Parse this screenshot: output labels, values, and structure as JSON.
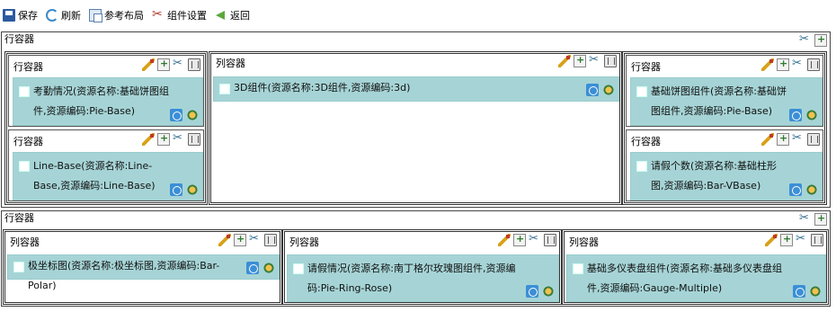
{
  "toolbar": {
    "save": "保存",
    "refresh": "刷新",
    "reference_layout": "参考布局",
    "component_settings": "组件设置",
    "back": "返回"
  },
  "row1": {
    "title": "行容器",
    "left_top": {
      "title": "行容器",
      "card": "考勤情况(资源名称:基础饼图组件,资源编码:Pie-Base)"
    },
    "left_bottom": {
      "title": "行容器",
      "card": "Line-Base(资源名称:Line-Base,资源编码:Line-Base)"
    },
    "middle": {
      "title": "列容器",
      "card": "3D组件(资源名称:3D组件,资源编码:3d)"
    },
    "right_top": {
      "title": "行容器",
      "card": "基础饼图组件(资源名称:基础饼图组件,资源编码:Pie-Base)"
    },
    "right_bottom": {
      "title": "行容器",
      "card": "请假个数(资源名称:基础柱形图,资源编码:Bar-VBase)"
    }
  },
  "row2": {
    "title": "行容器",
    "col1": {
      "title": "列容器",
      "card": "极坐标图(资源名称:极坐标图,资源编码:Bar-Polar)"
    },
    "col2": {
      "title": "列容器",
      "card": "请假情况(资源名称:南丁格尔玫瑰图组件,资源编码:Pie-Ring-Rose)"
    },
    "col3": {
      "title": "列容器",
      "card": "基础多仪表盘组件(资源名称:基础多仪表盘组件,资源编码:Gauge-Multiple)"
    }
  }
}
